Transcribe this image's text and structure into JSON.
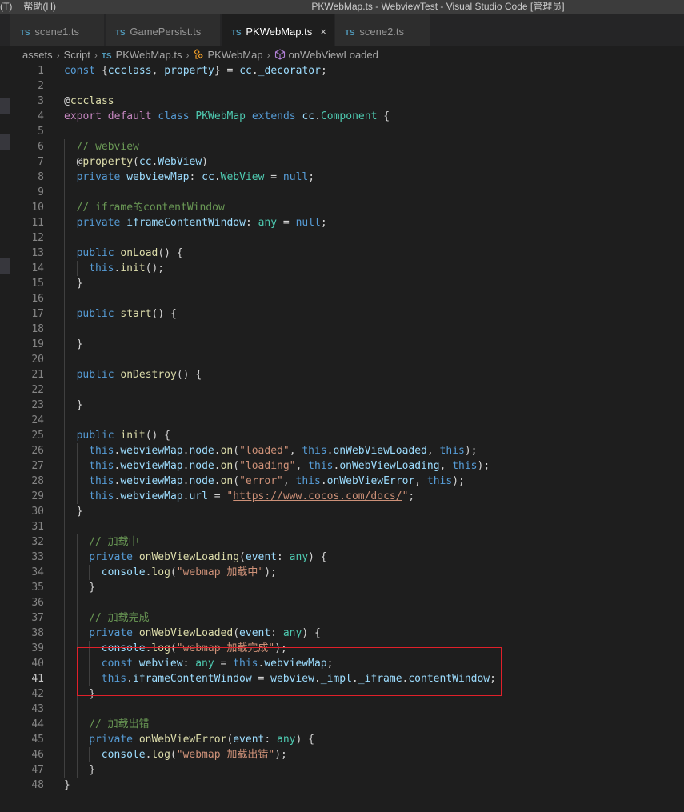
{
  "titlebar": {
    "menu": [
      "(T)",
      "帮助(H)"
    ],
    "title": "PKWebMap.ts - WebviewTest - Visual Studio Code [管理员]"
  },
  "tabs": [
    {
      "lang": "TS",
      "label": "scene1.ts",
      "active": false
    },
    {
      "lang": "TS",
      "label": "GamePersist.ts",
      "active": false
    },
    {
      "lang": "TS",
      "label": "PKWebMap.ts",
      "active": true,
      "close": "×"
    },
    {
      "lang": "TS",
      "label": "scene2.ts",
      "active": false
    }
  ],
  "breadcrumb": {
    "items": [
      "assets",
      "Script",
      "PKWebMap.ts",
      "PKWebMap",
      "onWebViewLoaded"
    ],
    "file_lang": "TS"
  },
  "editor": {
    "current_line": 41,
    "lines": [
      {
        "n": 1,
        "indent": 0,
        "tokens": [
          [
            "kw",
            "const"
          ],
          [
            "pun",
            " {"
          ],
          [
            "var",
            "ccclass"
          ],
          [
            "pun",
            ", "
          ],
          [
            "var",
            "property"
          ],
          [
            "pun",
            "} = "
          ],
          [
            "var",
            "cc"
          ],
          [
            "pun",
            "."
          ],
          [
            "var",
            "_decorator"
          ],
          [
            "pun",
            ";"
          ]
        ]
      },
      {
        "n": 2,
        "indent": 0,
        "tokens": []
      },
      {
        "n": 3,
        "indent": 0,
        "tokens": [
          [
            "pun",
            "@"
          ],
          [
            "fn",
            "ccclass"
          ]
        ]
      },
      {
        "n": 4,
        "indent": 0,
        "tokens": [
          [
            "ctl",
            "export"
          ],
          [
            "pun",
            " "
          ],
          [
            "ctl",
            "default"
          ],
          [
            "pun",
            " "
          ],
          [
            "kw",
            "class"
          ],
          [
            "pun",
            " "
          ],
          [
            "type",
            "PKWebMap"
          ],
          [
            "pun",
            " "
          ],
          [
            "kw",
            "extends"
          ],
          [
            "pun",
            " "
          ],
          [
            "var",
            "cc"
          ],
          [
            "pun",
            "."
          ],
          [
            "type",
            "Component"
          ],
          [
            "pun",
            " {"
          ]
        ]
      },
      {
        "n": 5,
        "indent": 0,
        "tokens": []
      },
      {
        "n": 6,
        "indent": 1,
        "tokens": [
          [
            "cm",
            "// webview"
          ]
        ]
      },
      {
        "n": 7,
        "indent": 1,
        "tokens": [
          [
            "pun",
            "@"
          ],
          [
            "dec",
            "property"
          ],
          [
            "pun",
            "("
          ],
          [
            "var",
            "cc"
          ],
          [
            "pun",
            "."
          ],
          [
            "var",
            "WebView"
          ],
          [
            "pun",
            ")"
          ]
        ]
      },
      {
        "n": 8,
        "indent": 1,
        "tokens": [
          [
            "kw",
            "private"
          ],
          [
            "pun",
            " "
          ],
          [
            "var",
            "webviewMap"
          ],
          [
            "pun",
            ": "
          ],
          [
            "var",
            "cc"
          ],
          [
            "pun",
            "."
          ],
          [
            "type",
            "WebView"
          ],
          [
            "pun",
            " = "
          ],
          [
            "kw",
            "null"
          ],
          [
            "pun",
            ";"
          ]
        ]
      },
      {
        "n": 9,
        "indent": 1,
        "tokens": []
      },
      {
        "n": 10,
        "indent": 1,
        "tokens": [
          [
            "cm",
            "// iframe的contentWindow"
          ]
        ]
      },
      {
        "n": 11,
        "indent": 1,
        "tokens": [
          [
            "kw",
            "private"
          ],
          [
            "pun",
            " "
          ],
          [
            "var",
            "iframeContentWindow"
          ],
          [
            "pun",
            ": "
          ],
          [
            "type",
            "any"
          ],
          [
            "pun",
            " = "
          ],
          [
            "kw",
            "null"
          ],
          [
            "pun",
            ";"
          ]
        ]
      },
      {
        "n": 12,
        "indent": 1,
        "tokens": []
      },
      {
        "n": 13,
        "indent": 1,
        "tokens": [
          [
            "kw",
            "public"
          ],
          [
            "pun",
            " "
          ],
          [
            "fn",
            "onLoad"
          ],
          [
            "pun",
            "() {"
          ]
        ]
      },
      {
        "n": 14,
        "indent": 2,
        "tokens": [
          [
            "kw",
            "this"
          ],
          [
            "pun",
            "."
          ],
          [
            "fn",
            "init"
          ],
          [
            "pun",
            "();"
          ]
        ]
      },
      {
        "n": 15,
        "indent": 1,
        "tokens": [
          [
            "pun",
            "}"
          ]
        ]
      },
      {
        "n": 16,
        "indent": 1,
        "tokens": []
      },
      {
        "n": 17,
        "indent": 1,
        "tokens": [
          [
            "kw",
            "public"
          ],
          [
            "pun",
            " "
          ],
          [
            "fn",
            "start"
          ],
          [
            "pun",
            "() {"
          ]
        ]
      },
      {
        "n": 18,
        "indent": 1,
        "tokens": []
      },
      {
        "n": 19,
        "indent": 1,
        "tokens": [
          [
            "pun",
            "}"
          ]
        ]
      },
      {
        "n": 20,
        "indent": 1,
        "tokens": []
      },
      {
        "n": 21,
        "indent": 1,
        "tokens": [
          [
            "kw",
            "public"
          ],
          [
            "pun",
            " "
          ],
          [
            "fn",
            "onDestroy"
          ],
          [
            "pun",
            "() {"
          ]
        ]
      },
      {
        "n": 22,
        "indent": 1,
        "tokens": []
      },
      {
        "n": 23,
        "indent": 1,
        "tokens": [
          [
            "pun",
            "}"
          ]
        ]
      },
      {
        "n": 24,
        "indent": 1,
        "tokens": []
      },
      {
        "n": 25,
        "indent": 1,
        "tokens": [
          [
            "kw",
            "public"
          ],
          [
            "pun",
            " "
          ],
          [
            "fn",
            "init"
          ],
          [
            "pun",
            "() {"
          ]
        ]
      },
      {
        "n": 26,
        "indent": 2,
        "tokens": [
          [
            "kw",
            "this"
          ],
          [
            "pun",
            "."
          ],
          [
            "var",
            "webviewMap"
          ],
          [
            "pun",
            "."
          ],
          [
            "var",
            "node"
          ],
          [
            "pun",
            "."
          ],
          [
            "fn",
            "on"
          ],
          [
            "pun",
            "("
          ],
          [
            "str",
            "\"loaded\""
          ],
          [
            "pun",
            ", "
          ],
          [
            "kw",
            "this"
          ],
          [
            "pun",
            "."
          ],
          [
            "var",
            "onWebViewLoaded"
          ],
          [
            "pun",
            ", "
          ],
          [
            "kw",
            "this"
          ],
          [
            "pun",
            ");"
          ]
        ]
      },
      {
        "n": 27,
        "indent": 2,
        "tokens": [
          [
            "kw",
            "this"
          ],
          [
            "pun",
            "."
          ],
          [
            "var",
            "webviewMap"
          ],
          [
            "pun",
            "."
          ],
          [
            "var",
            "node"
          ],
          [
            "pun",
            "."
          ],
          [
            "fn",
            "on"
          ],
          [
            "pun",
            "("
          ],
          [
            "str",
            "\"loading\""
          ],
          [
            "pun",
            ", "
          ],
          [
            "kw",
            "this"
          ],
          [
            "pun",
            "."
          ],
          [
            "var",
            "onWebViewLoading"
          ],
          [
            "pun",
            ", "
          ],
          [
            "kw",
            "this"
          ],
          [
            "pun",
            ");"
          ]
        ]
      },
      {
        "n": 28,
        "indent": 2,
        "tokens": [
          [
            "kw",
            "this"
          ],
          [
            "pun",
            "."
          ],
          [
            "var",
            "webviewMap"
          ],
          [
            "pun",
            "."
          ],
          [
            "var",
            "node"
          ],
          [
            "pun",
            "."
          ],
          [
            "fn",
            "on"
          ],
          [
            "pun",
            "("
          ],
          [
            "str",
            "\"error\""
          ],
          [
            "pun",
            ", "
          ],
          [
            "kw",
            "this"
          ],
          [
            "pun",
            "."
          ],
          [
            "var",
            "onWebViewError"
          ],
          [
            "pun",
            ", "
          ],
          [
            "kw",
            "this"
          ],
          [
            "pun",
            ");"
          ]
        ]
      },
      {
        "n": 29,
        "indent": 2,
        "tokens": [
          [
            "kw",
            "this"
          ],
          [
            "pun",
            "."
          ],
          [
            "var",
            "webviewMap"
          ],
          [
            "pun",
            "."
          ],
          [
            "var",
            "url"
          ],
          [
            "pun",
            " = "
          ],
          [
            "str",
            "\""
          ],
          [
            "url",
            "https://www.cocos.com/docs/"
          ],
          [
            "str",
            "\""
          ],
          [
            "pun",
            ";"
          ]
        ]
      },
      {
        "n": 30,
        "indent": 1,
        "tokens": [
          [
            "pun",
            "}"
          ]
        ]
      },
      {
        "n": 31,
        "indent": 1,
        "tokens": []
      },
      {
        "n": 32,
        "indent": 2,
        "tokens": [
          [
            "cm",
            "// 加载中"
          ]
        ]
      },
      {
        "n": 33,
        "indent": 2,
        "tokens": [
          [
            "kw",
            "private"
          ],
          [
            "pun",
            " "
          ],
          [
            "fn",
            "onWebViewLoading"
          ],
          [
            "pun",
            "("
          ],
          [
            "var",
            "event"
          ],
          [
            "pun",
            ": "
          ],
          [
            "type",
            "any"
          ],
          [
            "pun",
            ") {"
          ]
        ]
      },
      {
        "n": 34,
        "indent": 3,
        "tokens": [
          [
            "var",
            "console"
          ],
          [
            "pun",
            "."
          ],
          [
            "fn",
            "log"
          ],
          [
            "pun",
            "("
          ],
          [
            "str",
            "\"webmap 加载中\""
          ],
          [
            "pun",
            ");"
          ]
        ]
      },
      {
        "n": 35,
        "indent": 2,
        "tokens": [
          [
            "pun",
            "}"
          ]
        ]
      },
      {
        "n": 36,
        "indent": 2,
        "tokens": []
      },
      {
        "n": 37,
        "indent": 2,
        "tokens": [
          [
            "cm",
            "// 加载完成"
          ]
        ]
      },
      {
        "n": 38,
        "indent": 2,
        "tokens": [
          [
            "kw",
            "private"
          ],
          [
            "pun",
            " "
          ],
          [
            "fn",
            "onWebViewLoaded"
          ],
          [
            "pun",
            "("
          ],
          [
            "var",
            "event"
          ],
          [
            "pun",
            ": "
          ],
          [
            "type",
            "any"
          ],
          [
            "pun",
            ") {"
          ]
        ]
      },
      {
        "n": 39,
        "indent": 3,
        "tokens": [
          [
            "var",
            "console"
          ],
          [
            "pun",
            "."
          ],
          [
            "fn",
            "log"
          ],
          [
            "pun",
            "("
          ],
          [
            "str",
            "\"webmap 加载完成\""
          ],
          [
            "pun",
            ");"
          ]
        ]
      },
      {
        "n": 40,
        "indent": 3,
        "tokens": [
          [
            "kw",
            "const"
          ],
          [
            "pun",
            " "
          ],
          [
            "var",
            "webview"
          ],
          [
            "pun",
            ": "
          ],
          [
            "type",
            "any"
          ],
          [
            "pun",
            " = "
          ],
          [
            "kw",
            "this"
          ],
          [
            "pun",
            "."
          ],
          [
            "var",
            "webviewMap"
          ],
          [
            "pun",
            ";"
          ]
        ]
      },
      {
        "n": 41,
        "indent": 3,
        "tokens": [
          [
            "kw",
            "this"
          ],
          [
            "pun",
            "."
          ],
          [
            "var",
            "iframeContentWindow"
          ],
          [
            "pun",
            " = "
          ],
          [
            "var",
            "webview"
          ],
          [
            "pun",
            "."
          ],
          [
            "var",
            "_impl"
          ],
          [
            "pun",
            "."
          ],
          [
            "var",
            "_iframe"
          ],
          [
            "pun",
            "."
          ],
          [
            "var",
            "contentWindow"
          ],
          [
            "pun",
            ";"
          ]
        ]
      },
      {
        "n": 42,
        "indent": 2,
        "tokens": [
          [
            "pun",
            "}"
          ]
        ]
      },
      {
        "n": 43,
        "indent": 2,
        "tokens": []
      },
      {
        "n": 44,
        "indent": 2,
        "tokens": [
          [
            "cm",
            "// 加载出错"
          ]
        ]
      },
      {
        "n": 45,
        "indent": 2,
        "tokens": [
          [
            "kw",
            "private"
          ],
          [
            "pun",
            " "
          ],
          [
            "fn",
            "onWebViewError"
          ],
          [
            "pun",
            "("
          ],
          [
            "var",
            "event"
          ],
          [
            "pun",
            ": "
          ],
          [
            "type",
            "any"
          ],
          [
            "pun",
            ") {"
          ]
        ]
      },
      {
        "n": 46,
        "indent": 3,
        "tokens": [
          [
            "var",
            "console"
          ],
          [
            "pun",
            "."
          ],
          [
            "fn",
            "log"
          ],
          [
            "pun",
            "("
          ],
          [
            "str",
            "\"webmap 加载出错\""
          ],
          [
            "pun",
            ");"
          ]
        ]
      },
      {
        "n": 47,
        "indent": 2,
        "tokens": [
          [
            "pun",
            "}"
          ]
        ]
      },
      {
        "n": 48,
        "indent": 0,
        "tokens": [
          [
            "pun",
            "}"
          ]
        ]
      }
    ]
  }
}
